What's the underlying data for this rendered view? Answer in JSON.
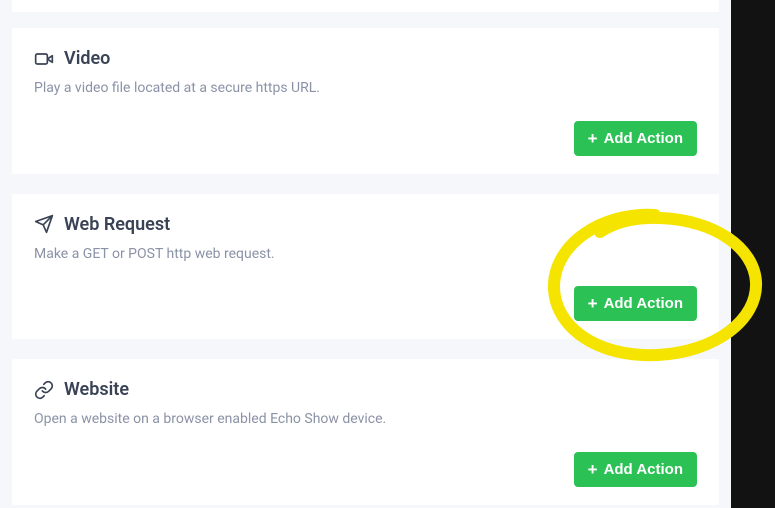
{
  "actions": [
    {
      "icon": "video-icon",
      "title": "Video",
      "description": "Play a video file located at a secure https URL.",
      "button_label": "Add Action"
    },
    {
      "icon": "send-icon",
      "title": "Web Request",
      "description": "Make a GET or POST http web request.",
      "button_label": "Add Action"
    },
    {
      "icon": "link-icon",
      "title": "Website",
      "description": "Open a website on a browser enabled Echo Show device.",
      "button_label": "Add Action"
    }
  ],
  "colors": {
    "accent": "#2bc155",
    "annotation": "#f5e400"
  }
}
